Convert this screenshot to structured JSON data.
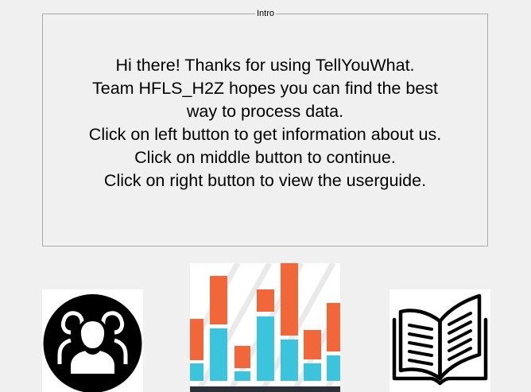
{
  "intro": {
    "legend": "Intro",
    "lines": [
      "Hi there! Thanks for using TellYouWhat.",
      "Team HFLS_H2Z hopes you can find the best",
      "way to process data.",
      "Click on left button to get information about us.",
      "Click on middle button to continue.",
      "Click on right button to view the userguide."
    ]
  },
  "buttons": {
    "about": {
      "icon": "users-group-icon"
    },
    "continue": {
      "icon": "bar-chart-icon"
    },
    "guide": {
      "icon": "open-book-icon"
    }
  },
  "colors": {
    "background": "#f0f0f0",
    "border": "#a9a9a9",
    "chart_orange": "#f2673a",
    "chart_cyan": "#3cc4dc",
    "chart_dark": "#2b2f38"
  }
}
